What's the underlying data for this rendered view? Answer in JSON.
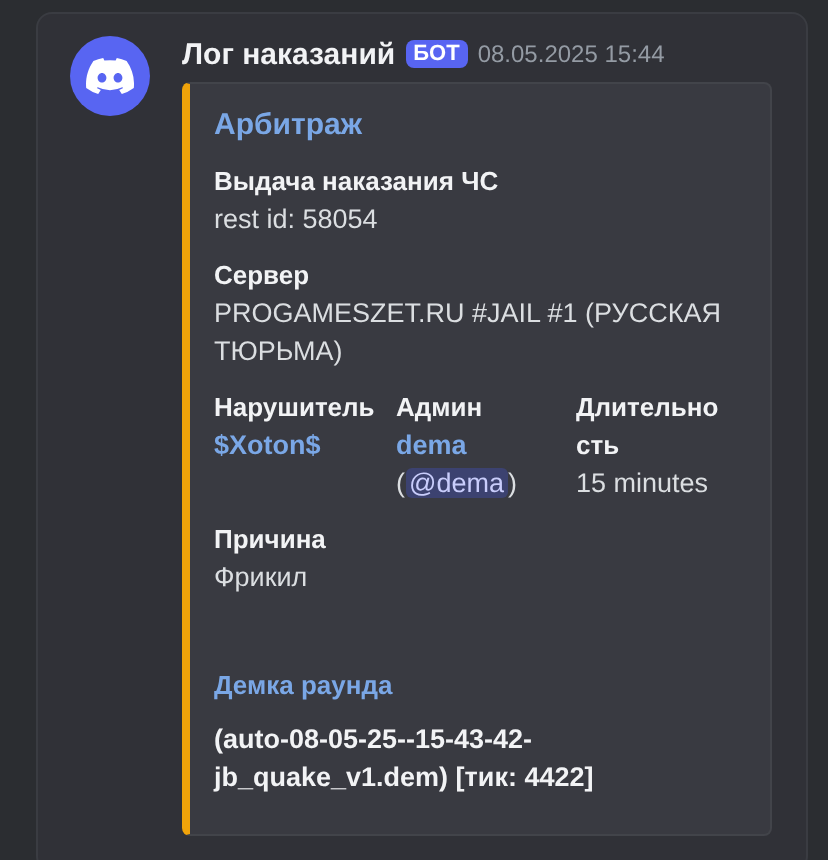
{
  "message": {
    "author": "Лог наказаний",
    "badge": "БОТ",
    "timestamp": "08.05.2025 15:44",
    "embed": {
      "color": "#f0a30a",
      "title": "Арбитраж",
      "fields": [
        {
          "kind": "plain",
          "inline": false,
          "name": "Выдача наказания ЧС",
          "lines": [
            [
              {
                "kind": "text",
                "text": "rest id: 58054"
              }
            ]
          ]
        },
        {
          "kind": "plain",
          "inline": false,
          "name": "Сервер",
          "lines": [
            [
              {
                "kind": "text",
                "text": "PROGAMESZET.RU #JAIL #1 (РУССКАЯ ТЮРЬМА)"
              }
            ]
          ]
        },
        {
          "kind": "plain",
          "inline": true,
          "name": "Нарушитель",
          "lines": [
            [
              {
                "kind": "link",
                "text": "$Xoton$"
              }
            ]
          ]
        },
        {
          "kind": "plain",
          "inline": true,
          "name": "Админ",
          "lines": [
            [
              {
                "kind": "link",
                "text": "dema"
              }
            ],
            [
              {
                "kind": "text",
                "text": "("
              },
              {
                "kind": "mention",
                "text": "@dema"
              },
              {
                "kind": "text",
                "text": ")"
              }
            ]
          ]
        },
        {
          "kind": "plain",
          "inline": true,
          "name": "Длительность",
          "lines": [
            [
              {
                "kind": "text",
                "text": "15 minutes"
              }
            ]
          ]
        },
        {
          "kind": "plain",
          "inline": false,
          "name": "Причина",
          "lines": [
            [
              {
                "kind": "text",
                "text": "Фрикил"
              }
            ]
          ]
        },
        {
          "kind": "highlight",
          "inline": false,
          "name": "Демка раунда",
          "lines": [
            [
              {
                "kind": "text",
                "text": "(auto-08-05-25--15-43-42-jb_quake_v1.dem) [тик: 4422]"
              }
            ]
          ]
        }
      ]
    }
  }
}
